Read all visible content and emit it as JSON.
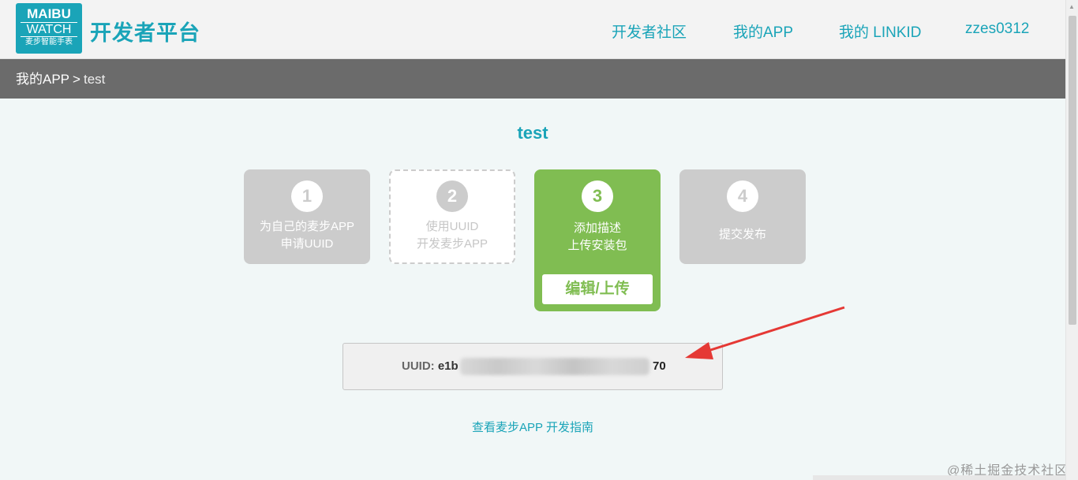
{
  "logo": {
    "line1": "MAIBU",
    "line2": "WATCH",
    "line3": "麦步智能手表"
  },
  "header": {
    "title": "开发者平台",
    "nav": [
      "开发者社区",
      "我的APP",
      "我的 LINKID",
      "zzes0312"
    ]
  },
  "breadcrumb": {
    "parent": "我的APP",
    "separator": ">",
    "current": "test"
  },
  "app": {
    "name": "test"
  },
  "steps": [
    {
      "num": "1",
      "line1": "为自己的麦步APP",
      "line2": "申请UUID"
    },
    {
      "num": "2",
      "line1": "使用UUID",
      "line2": "开发麦步APP"
    },
    {
      "num": "3",
      "line1": "添加描述",
      "line2": "上传安装包",
      "button": "编辑/上传"
    },
    {
      "num": "4",
      "line1": "提交发布"
    }
  ],
  "uuid": {
    "label": "UUID:",
    "prefix": "e1b",
    "suffix": "70"
  },
  "guide_link": "查看麦步APP 开发指南",
  "watermark": "@稀土掘金技术社区",
  "colors": {
    "accent": "#1aa4b8",
    "active_step": "#80bd52",
    "inactive_step": "#cccccc",
    "breadcrumb_bar": "#6b6b6b",
    "annotation_arrow": "#e53935"
  }
}
